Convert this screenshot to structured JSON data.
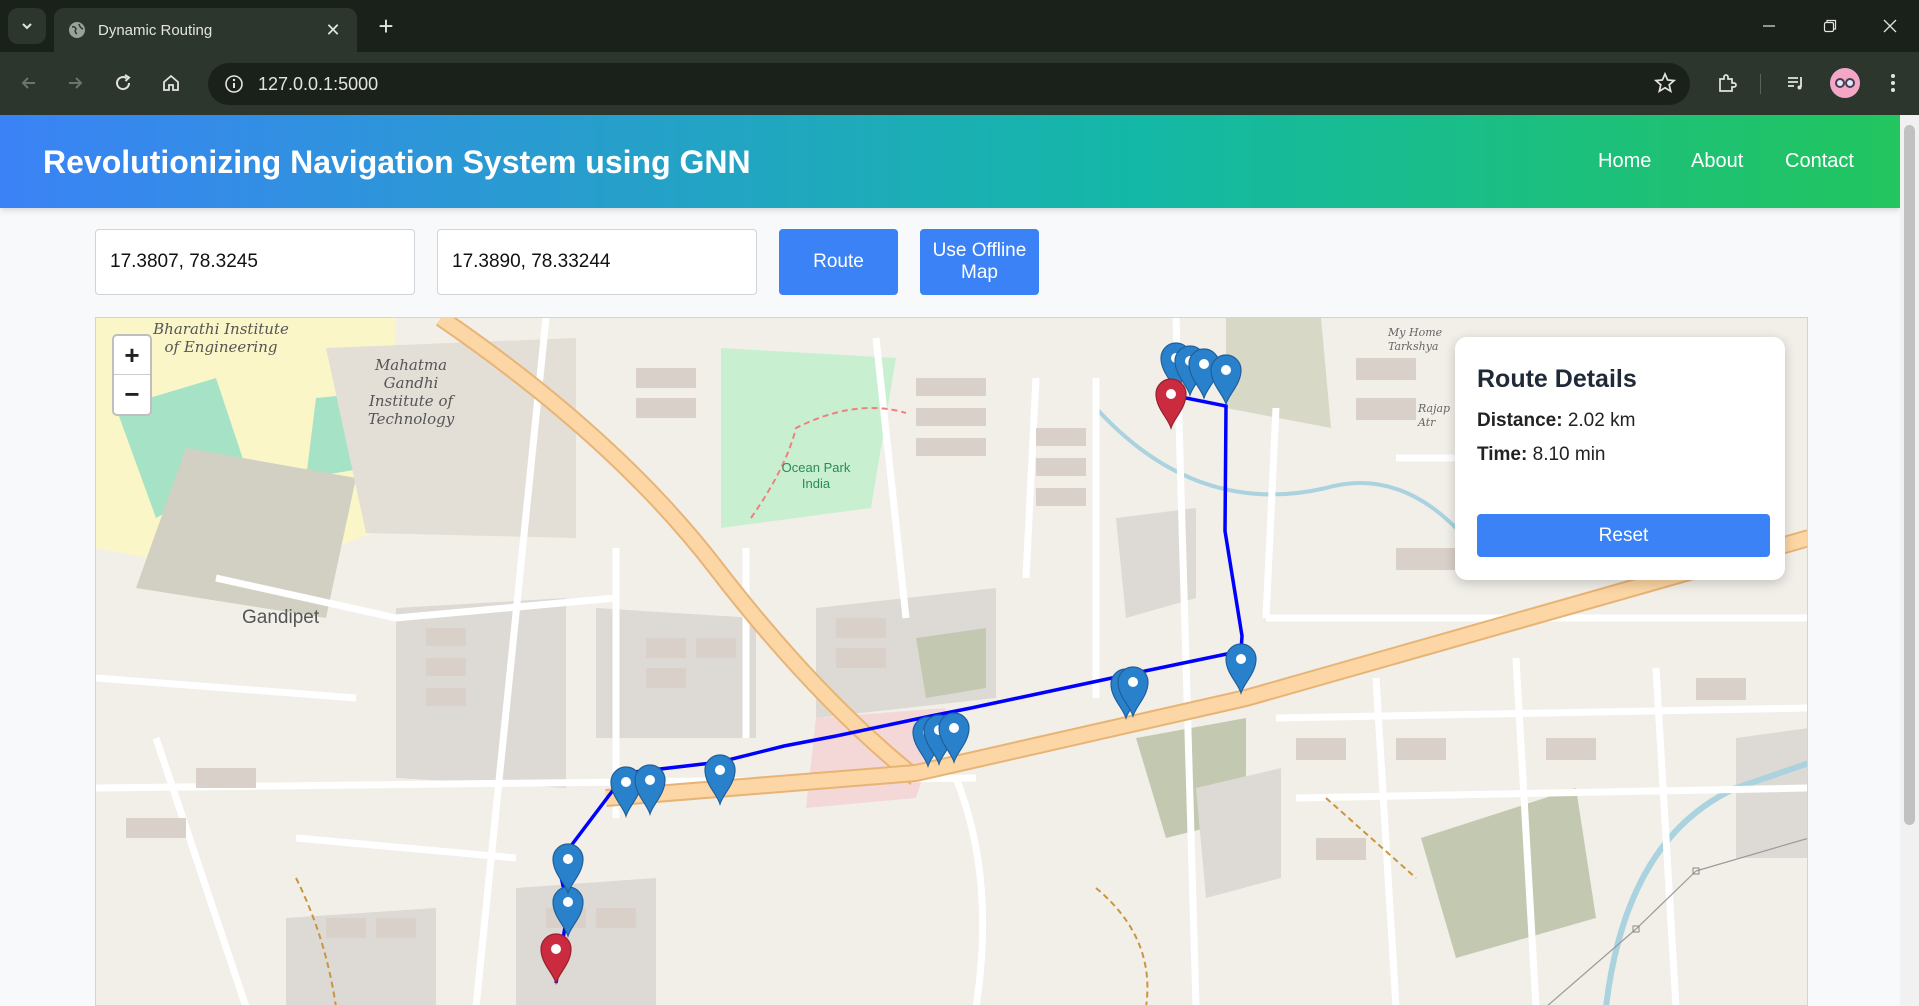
{
  "browser": {
    "tab_title": "Dynamic Routing",
    "url": "127.0.0.1:5000"
  },
  "header": {
    "title": "Revolutionizing Navigation System using GNN",
    "nav": [
      "Home",
      "About",
      "Contact"
    ]
  },
  "form": {
    "source_value": "17.3807, 78.3245",
    "destination_value": "17.3890, 78.33244",
    "route_label": "Route",
    "offline_label": "Use Offline Map"
  },
  "map": {
    "zoom_in": "+",
    "zoom_out": "−",
    "labels": {
      "bharathi": "Bharathi Institute of Engineering",
      "mahatma": "Mahatma Gandhi Institute of Technology",
      "ocean": "Ocean Park India",
      "gandipet": "Gandipet",
      "myhome": "My Home Tarkshya",
      "rajapushpa": "Rajap Atr"
    },
    "route_color": "#0000ff",
    "marker_blue": "#2a81cb",
    "marker_red": "#cb2b3e"
  },
  "route_details": {
    "title": "Route Details",
    "distance_label": "Distance:",
    "distance_value": "2.02 km",
    "time_label": "Time:",
    "time_value": "8.10 min",
    "reset_label": "Reset"
  }
}
